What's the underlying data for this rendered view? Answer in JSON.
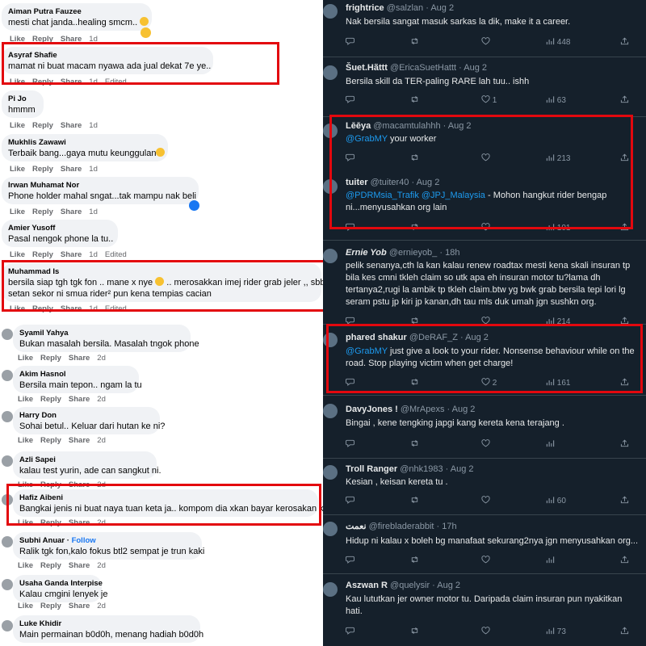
{
  "facebook": {
    "actions": {
      "like": "Like",
      "reply": "Reply",
      "share": "Share"
    },
    "comments": [
      {
        "name": "Aiman Putra Fauzee",
        "text": "mesti chat janda..healing smcm..",
        "time": "1d",
        "edited": ""
      },
      {
        "name": "Asyraf Shafie",
        "text": "mamat ni buat macam nyawa ada jual dekat 7e ye..",
        "time": "1d",
        "edited": "Edited"
      },
      {
        "name": "Pi Jo",
        "text": "hmmm",
        "time": "1d",
        "edited": ""
      },
      {
        "name": "Mukhlis Zawawi",
        "text": "Terbaik bang...gaya mutu keunggulan",
        "time": "1d",
        "edited": ""
      },
      {
        "name": "Irwan Muhamat Nor",
        "text": "Phone holder mahal sngat...tak mampu nak beli",
        "time": "1d",
        "edited": ""
      },
      {
        "name": "Amier Yusoff",
        "text": "Pasal nengok phone la tu..",
        "time": "1d",
        "edited": "Edited"
      },
      {
        "name": "Muhammad Is",
        "text": "bersila siap tgh tgk fon .. mane x nye",
        "text2": ".. merosakkan imej rider grab jeler ,, sbb",
        "text3": "setan sekor ni smua rider² pun kena tempias cacian",
        "time": "1d",
        "edited": "Edited"
      },
      {
        "name": "Syamil Yahya",
        "text": "Bukan masalah bersila. Masalah tngok phone",
        "time": "2d",
        "edited": ""
      },
      {
        "name": "Akim Hasnol",
        "text": "Bersila main tepon.. ngam la tu",
        "time": "2d",
        "edited": ""
      },
      {
        "name": "Harry Don",
        "text": "Sohai betul.. Keluar dari hutan ke ni?",
        "time": "2d",
        "edited": ""
      },
      {
        "name": "Azli Sapei",
        "text": "kalau test yurin, ade can sangkut ni.",
        "time": "2d",
        "edited": ""
      },
      {
        "name": "Hafiz Aibeni",
        "text": "Bangkai jenis ni buat naya tuan keta ja.. kompom dia xkan bayar kerosakan keta..",
        "time": "2d",
        "edited": ""
      },
      {
        "name": "Subhi Anuar",
        "follow": "Follow",
        "text": "Ralik tgk fon,kalo fokus btl2 sempat je trun kaki",
        "time": "2d",
        "edited": ""
      },
      {
        "name": "Usaha Ganda Interpise",
        "text": "Kalau cmgini lenyek je",
        "time": "2d",
        "edited": ""
      },
      {
        "name": "Luke Khidir",
        "text": "Main permainan b0d0h, menang hadiah b0d0h",
        "time": "",
        "edited": ""
      }
    ]
  },
  "twitter": {
    "tweets": [
      {
        "name": "frightrice",
        "handle": "@salzlan",
        "date": "Aug 2",
        "text": "Nak bersila sangat masuk sarkas la dik, make it a career.",
        "likes": "",
        "views": "448"
      },
      {
        "name": "Šuet.Hãttt",
        "handle": "@EricaSuetHattt",
        "date": "Aug 2",
        "text": "Bersila skill da TER-paling RARE lah tuu.. ishh",
        "likes": "1",
        "views": "63"
      },
      {
        "name": "Lēēya",
        "handle": "@macamtulahhh",
        "date": "Aug 2",
        "mention": "@GrabMY",
        "text": " your worker",
        "likes": "",
        "views": "213"
      },
      {
        "name": "tuiter",
        "handle": "@tuiter40",
        "date": "Aug 2",
        "mention": "@PDRMsia_Trafik",
        "mention2": "@JPJ_Malaysia",
        "text": " - Mohon hangkut rider bengap",
        "text2": "ni...menyusahkan org lain",
        "likes": "",
        "views": "101"
      },
      {
        "name": "Ernie Yob",
        "handle": "@ernieyob_",
        "date": "18h",
        "lines": [
          "pelik senanya,cth la kan kalau renew roadtax mesti kena skali insuran tp",
          "bila kes cmni tkleh claim so utk apa eh insuran motor tu?lama dh",
          "tertanya2,rugi la ambik tp tkleh claim.btw yg bwk grab bersila tepi lori lg",
          "seram pstu jp kiri jp kanan,dh tau mls duk umah jgn sushkn org."
        ],
        "likes": "",
        "views": "214"
      },
      {
        "name": "phared shakur",
        "handle": "@DeRAF_Z",
        "date": "Aug 2",
        "mention": "@GrabMY",
        "text": " just give a look to your rider. Nonsense behaviour while on the",
        "text2": "road. Stop playing victim when get charge!",
        "likes": "2",
        "views": "161"
      },
      {
        "name": "DavyJones !",
        "handle": "@MrApexs",
        "date": "Aug 2",
        "text": "Bingai , kene tengking japgi kang kereta kena terajang .",
        "likes": "",
        "views": ""
      },
      {
        "name": "Troll Ranger",
        "handle": "@nhk1983",
        "date": "Aug 2",
        "text": "Kesian , keisan kereta tu .",
        "likes": "",
        "views": "60"
      },
      {
        "name": "نعمت",
        "handle": "@firebladerabbit",
        "date": "17h",
        "text": "Hidup ni kalau x boleh bg manafaat sekurang2nya jgn menyusahkan org...",
        "likes": "",
        "views": ""
      },
      {
        "name": "Aszwan R",
        "handle": "@quelysir",
        "date": "Aug 2",
        "text": "Kau lututkan jer owner  motor tu. Daripada claim insuran pun nyakitkan",
        "text2": "hati.",
        "likes": "",
        "views": "73"
      }
    ]
  },
  "colors": {
    "highlight": "#e3080e",
    "mention": "#1d9bf0",
    "twitter_bg": "#15202b",
    "fb_link": "#1877f2"
  }
}
